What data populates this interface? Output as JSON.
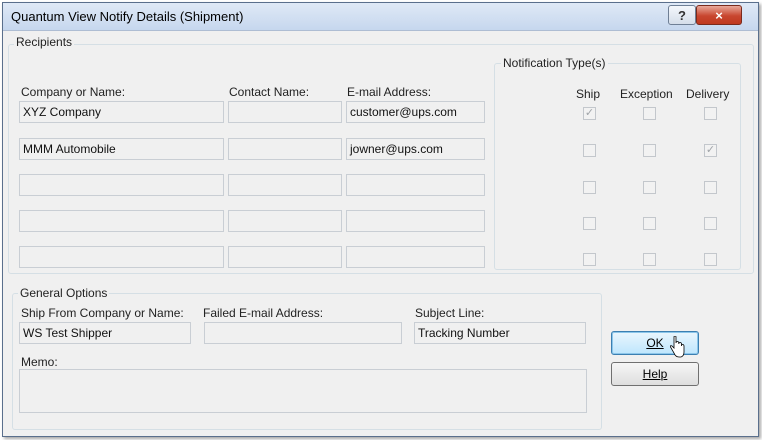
{
  "window": {
    "title": "Quantum View Notify Details (Shipment)"
  },
  "titlebar": {
    "help_glyph": "?",
    "close_glyph": "×"
  },
  "recipients": {
    "group_label": "Recipients",
    "col_company": "Company or Name:",
    "col_contact": "Contact Name:",
    "col_email": "E-mail Address:",
    "rows": [
      {
        "company": "XYZ Company",
        "contact": "",
        "email": "customer@ups.com"
      },
      {
        "company": "MMM Automobile",
        "contact": "",
        "email": "jowner@ups.com"
      },
      {
        "company": "",
        "contact": "",
        "email": ""
      },
      {
        "company": "",
        "contact": "",
        "email": ""
      },
      {
        "company": "",
        "contact": "",
        "email": ""
      }
    ]
  },
  "notification": {
    "group_label": "Notification Type(s)",
    "col_ship": "Ship",
    "col_exception": "Exception",
    "col_delivery": "Delivery",
    "rows": [
      {
        "ship": true,
        "exception": false,
        "delivery": false
      },
      {
        "ship": false,
        "exception": false,
        "delivery": true
      },
      {
        "ship": false,
        "exception": false,
        "delivery": false
      },
      {
        "ship": false,
        "exception": false,
        "delivery": false
      },
      {
        "ship": false,
        "exception": false,
        "delivery": false
      }
    ]
  },
  "general": {
    "group_label": "General Options",
    "ship_from_label": "Ship From Company or Name:",
    "ship_from_value": "WS Test Shipper",
    "failed_email_label": "Failed E-mail Address:",
    "failed_email_value": "",
    "subject_label": "Subject Line:",
    "subject_value": "Tracking Number",
    "memo_label": "Memo:",
    "memo_value": ""
  },
  "buttons": {
    "ok": "OK",
    "help": "Help"
  }
}
